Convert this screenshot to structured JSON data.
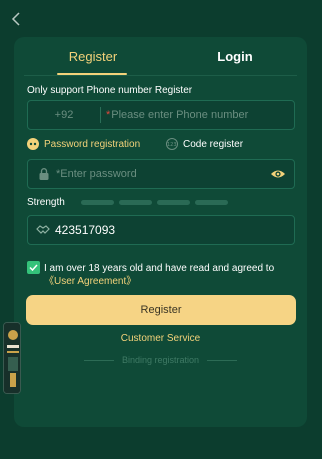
{
  "icons": {
    "back": "chevron-left-icon",
    "password_option": "dots-icon",
    "code_option": "code-123-icon",
    "lock": "lock-icon",
    "eye": "eye-icon",
    "captcha": "handshake-icon",
    "checkbox": "check-icon"
  },
  "colors": {
    "background": "#0c3d2e",
    "panel": "#0f4a37",
    "accent": "#f3d27a",
    "button": "#f6d485",
    "checkbox": "#34c27a",
    "required": "#e0463c"
  },
  "tabs": {
    "register": "Register",
    "login": "Login",
    "active": "Register"
  },
  "form": {
    "hint": "Only support Phone number Register",
    "phone_prefix": "+92",
    "phone_placeholder": "Please enter Phone number",
    "required_mark": "*",
    "option_password": "Password registration",
    "option_code": "Code register",
    "password_placeholder": "*Enter password",
    "strength_label": "Strength",
    "strength_level": 0,
    "strength_segments": 4,
    "captcha_value": "423517093",
    "agree_text": "I am over 18 years old and have read and agreed to ",
    "agree_link": "《User Agreement》",
    "agree_checked": true
  },
  "actions": {
    "register_button": "Register",
    "customer_service": "Customer Service",
    "binding_registration": "Binding registration"
  }
}
